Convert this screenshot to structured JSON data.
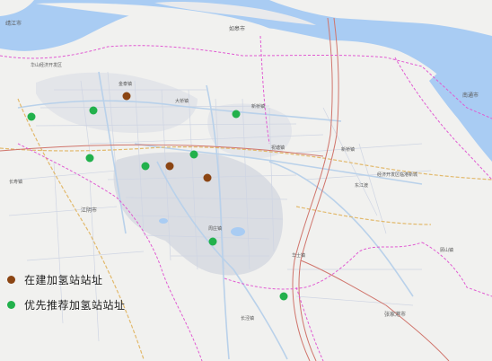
{
  "colors": {
    "water": "#a9ccf3",
    "land": "#f1f1ef",
    "city": "#d8dbe2",
    "road_minor": "#cfd5e3",
    "road_main": "#bcd3ea",
    "expressway": "#e8ca7e",
    "railway": "#d0756c",
    "boundary": "#e15bd2",
    "under_construction": "#8b4513",
    "recommended": "#22b14c"
  },
  "places": [
    {
      "id": "jingjiang",
      "text": "靖江市"
    },
    {
      "id": "rugao",
      "text": "如皋市"
    },
    {
      "id": "nantong",
      "text": "南通市"
    },
    {
      "id": "jinwan",
      "text": "金泰镇"
    },
    {
      "id": "daqiao",
      "text": "大桥镇"
    },
    {
      "id": "xinqiao",
      "text": "新桥镇"
    },
    {
      "id": "zhutang",
      "text": "祝塘镇"
    },
    {
      "id": "jiangyin",
      "text": "江阴市"
    },
    {
      "id": "changshou",
      "text": "长寿镇"
    },
    {
      "id": "zhouzhuang",
      "text": "周庄镇"
    },
    {
      "id": "huashi",
      "text": "华士镇"
    },
    {
      "id": "xinqiao2",
      "text": "新桥镇"
    },
    {
      "id": "dongjiangdu",
      "text": "东江渡"
    },
    {
      "id": "devzone",
      "text": "华山经济开发区"
    },
    {
      "id": "industrial",
      "text": "经济开发区临港新城"
    },
    {
      "id": "changjing",
      "text": "长泾镇"
    },
    {
      "id": "gushan",
      "text": "顾山镇"
    },
    {
      "id": "zhangjiagang",
      "text": "张家港市"
    }
  ],
  "sites": {
    "under_construction": [
      {
        "id": "uc-1",
        "label": "在建加氢站站址"
      },
      {
        "id": "uc-2",
        "label": "在建加氢站站址"
      },
      {
        "id": "uc-3",
        "label": "在建加氢站站址"
      }
    ],
    "recommended": [
      {
        "id": "r-1",
        "label": "优先推荐加氢站站址"
      },
      {
        "id": "r-2",
        "label": "优先推荐加氢站站址"
      },
      {
        "id": "r-3",
        "label": "优先推荐加氢站站址"
      },
      {
        "id": "r-4",
        "label": "优先推荐加氢站站址"
      },
      {
        "id": "r-5",
        "label": "优先推荐加氢站站址"
      },
      {
        "id": "r-6",
        "label": "优先推荐加氢站站址"
      },
      {
        "id": "r-7",
        "label": "优先推荐加氢站站址"
      },
      {
        "id": "r-8",
        "label": "优先推荐加氢站站址"
      }
    ]
  },
  "legend": {
    "under_construction_label": "在建加氢站站址",
    "recommended_label": "优先推荐加氢站站址"
  }
}
